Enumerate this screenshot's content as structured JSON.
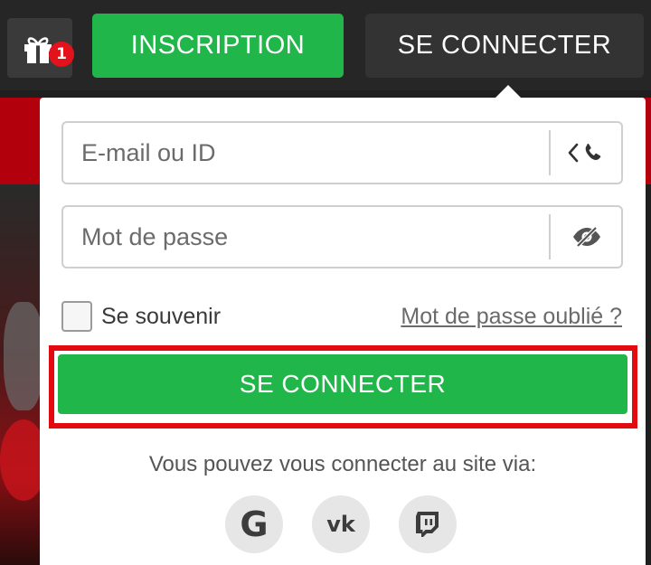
{
  "header": {
    "gift": {
      "icon": "gift-icon",
      "badge_count": "1",
      "badge_color": "#e3121b"
    },
    "register_label": "INSCRIPTION",
    "login_label": "SE CONNECTER"
  },
  "login_form": {
    "email": {
      "placeholder": "E-mail ou ID",
      "value": "",
      "switch_icon": "chevron-phone-icon"
    },
    "password": {
      "placeholder": "Mot de passe",
      "value": "",
      "toggle_icon": "eye-slash-icon"
    },
    "remember_label": "Se souvenir",
    "remember_checked": false,
    "forgot_label": "Mot de passe oublié ?",
    "submit_label": "SE CONNECTER",
    "social_text": "Vous pouvez vous connecter au site via:",
    "social": [
      {
        "icon": "google-icon",
        "glyph": "G"
      },
      {
        "icon": "vk-icon",
        "glyph": "vk"
      },
      {
        "icon": "twitch-icon"
      }
    ]
  },
  "colors": {
    "accent_green": "#21b64a",
    "topbar": "#262626",
    "highlight_outline": "#e30b10"
  }
}
